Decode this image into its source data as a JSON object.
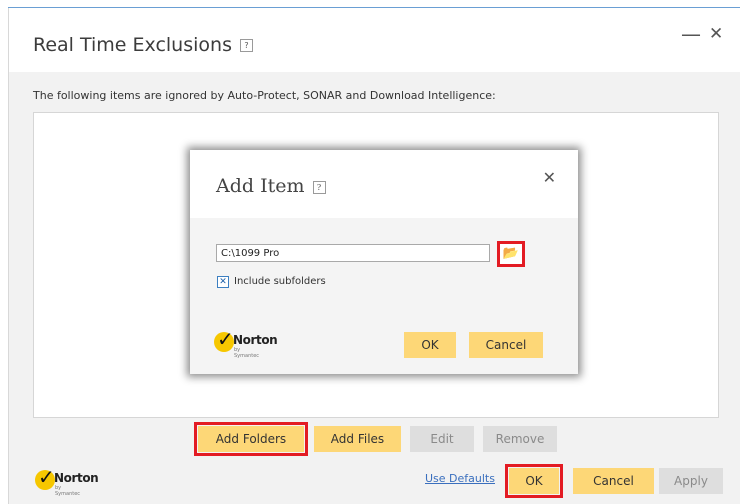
{
  "window": {
    "title": "Real Time Exclusions",
    "help_glyph": "?",
    "minimize_glyph": "—",
    "close_glyph": "✕",
    "description": "The following items are ignored by Auto-Protect, SONAR and Download Intelligence:"
  },
  "buttons": {
    "add_folders": "Add Folders",
    "add_files": "Add Files",
    "edit": "Edit",
    "remove": "Remove"
  },
  "footer": {
    "use_defaults": "Use Defaults",
    "ok": "OK",
    "cancel": "Cancel",
    "apply": "Apply"
  },
  "logo": {
    "brand": "Norton",
    "sub": "by Symantec",
    "checkmark": "✓"
  },
  "dialog": {
    "title": "Add Item",
    "help_glyph": "?",
    "close_glyph": "✕",
    "path_value": "C:\\1099 Pro",
    "browse_icon": "📂",
    "include_subfolders_label": "Include subfolders",
    "include_subfolders_checked": true,
    "check_glyph": "✕",
    "ok": "OK",
    "cancel": "Cancel"
  },
  "colors": {
    "accent_button": "#fdd777",
    "highlight": "#e31b23",
    "link": "#3a6fbe"
  }
}
